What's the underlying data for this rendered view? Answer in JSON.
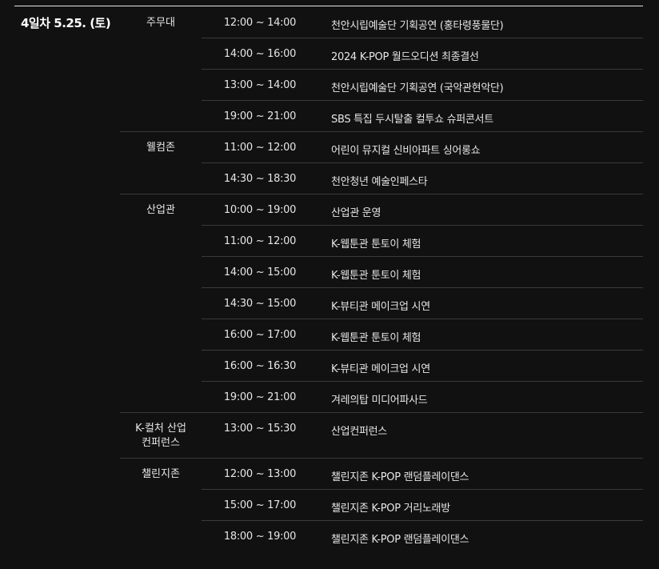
{
  "schedule": {
    "day_label": "4일차 5.25. (토)",
    "venues": [
      {
        "name": "주무대",
        "events": [
          {
            "time": "12:00 ~ 14:00",
            "title": "천안시립예술단 기획공연 (홍타령풍물단)"
          },
          {
            "time": "14:00 ~ 16:00",
            "title": "2024 K-POP 월드오디션 최종결선"
          },
          {
            "time": "13:00 ~ 14:00",
            "title": "천안시립예술단 기획공연 (국악관현악단)"
          },
          {
            "time": "19:00 ~ 21:00",
            "title": "SBS 특집 두시탈출 컬투쇼 슈퍼콘서트"
          }
        ]
      },
      {
        "name": "웰컴존",
        "events": [
          {
            "time": "11:00 ~ 12:00",
            "title": "어린이 뮤지컬 신비아파트 싱어롱쇼"
          },
          {
            "time": "14:30 ~ 18:30",
            "title": "천안청년 예술인페스타"
          }
        ]
      },
      {
        "name": "산업관",
        "events": [
          {
            "time": "10:00 ~ 19:00",
            "title": "산업관 운영"
          },
          {
            "time": "11:00 ~ 12:00",
            "title": "K-웹툰관 툰토이 체험"
          },
          {
            "time": "14:00 ~ 15:00",
            "title": "K-웹툰관 툰토이 체험"
          },
          {
            "time": "14:30 ~ 15:00",
            "title": "K-뷰티관 메이크업 시연"
          },
          {
            "time": "16:00 ~ 17:00",
            "title": "K-웹툰관 툰토이 체험"
          },
          {
            "time": "16:00 ~ 16:30",
            "title": "K-뷰티관 메이크업 시연"
          },
          {
            "time": "19:00 ~ 21:00",
            "title": "겨레의탑 미디어파사드"
          }
        ]
      },
      {
        "name": "K-컬처 산업\n컨퍼런스",
        "events": [
          {
            "time": "13:00 ~ 15:30",
            "title": "산업컨퍼런스"
          }
        ]
      },
      {
        "name": "챌린지존",
        "events": [
          {
            "time": "12:00 ~ 13:00",
            "title": "챌린지존 K-POP 랜덤플레이댄스"
          },
          {
            "time": "15:00 ~ 17:00",
            "title": "챌린지존 K-POP 거리노래방"
          },
          {
            "time": "18:00 ~ 19:00",
            "title": "챌린지존 K-POP 랜덤플레이댄스"
          }
        ]
      }
    ]
  }
}
